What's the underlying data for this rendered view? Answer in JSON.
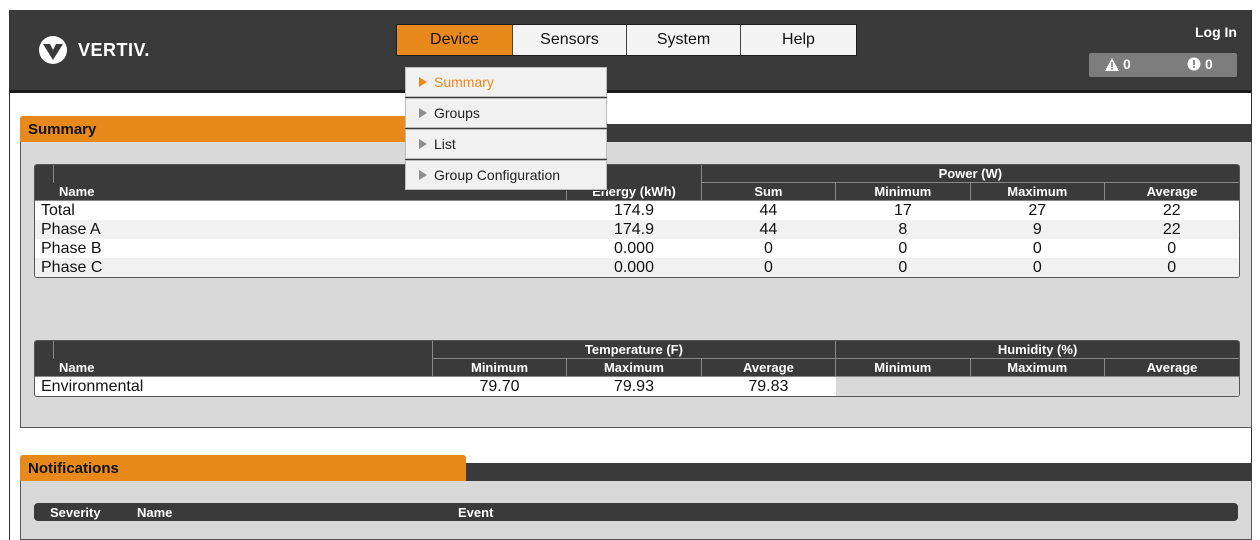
{
  "header": {
    "logo_text": "VERTIV.",
    "login_label": "Log In",
    "alarms": {
      "warning_count": "0",
      "critical_count": "0"
    }
  },
  "nav": {
    "tabs": [
      {
        "label": "Device",
        "active": true
      },
      {
        "label": "Sensors",
        "active": false
      },
      {
        "label": "System",
        "active": false
      },
      {
        "label": "Help",
        "active": false
      }
    ],
    "dropdown": [
      {
        "label": "Summary",
        "active": true
      },
      {
        "label": "Groups",
        "active": false
      },
      {
        "label": "List",
        "active": false
      },
      {
        "label": "Group Configuration",
        "active": false
      }
    ]
  },
  "summary": {
    "title": "Summary",
    "power_table": {
      "group_header_power": "Power (W)",
      "columns": [
        "Name",
        "Energy (kWh)",
        "Sum",
        "Minimum",
        "Maximum",
        "Average"
      ],
      "rows": [
        [
          "Total",
          "174.9",
          "44",
          "17",
          "27",
          "22"
        ],
        [
          "Phase A",
          "174.9",
          "44",
          "8",
          "9",
          "22"
        ],
        [
          "Phase B",
          "0.000",
          "0",
          "0",
          "0",
          "0"
        ],
        [
          "Phase C",
          "0.000",
          "0",
          "0",
          "0",
          "0"
        ]
      ]
    },
    "env_table": {
      "group_header_temp": "Temperature (F)",
      "group_header_humidity": "Humidity (%)",
      "columns": [
        "Name",
        "Minimum",
        "Maximum",
        "Average",
        "Minimum",
        "Maximum",
        "Average"
      ],
      "rows": [
        [
          "Environmental",
          "79.70",
          "79.93",
          "79.83"
        ]
      ]
    }
  },
  "notifications": {
    "title": "Notifications",
    "columns": [
      "Severity",
      "Name",
      "Event"
    ]
  },
  "colors": {
    "accent": "#e8891b",
    "dark": "#3a3a3a",
    "panel": "#d9d9d9"
  }
}
